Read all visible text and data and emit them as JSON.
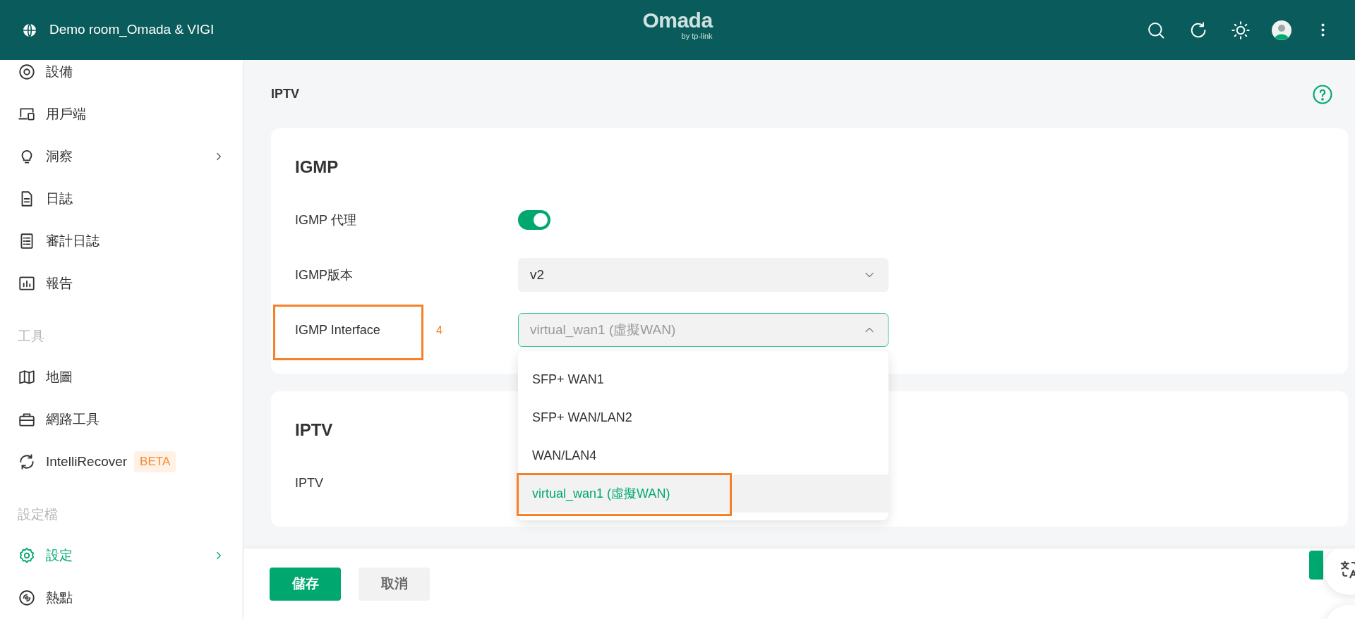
{
  "header": {
    "site_name": "Demo room_Omada & VIGI",
    "logo": "Omada",
    "logo_sub": "by tp-link"
  },
  "sidebar": {
    "items": [
      {
        "kind": "item",
        "label": "設備",
        "selected": false,
        "expandable": false
      },
      {
        "kind": "item",
        "label": "用戶端",
        "selected": false,
        "expandable": false
      },
      {
        "kind": "item",
        "label": "洞察",
        "selected": false,
        "expandable": true
      },
      {
        "kind": "item",
        "label": "日誌",
        "selected": false,
        "expandable": false
      },
      {
        "kind": "item",
        "label": "審計日誌",
        "selected": false,
        "expandable": false
      },
      {
        "kind": "item",
        "label": "報告",
        "selected": false,
        "expandable": false
      },
      {
        "kind": "section",
        "label": "工具"
      },
      {
        "kind": "item",
        "label": "地圖",
        "selected": false,
        "expandable": false
      },
      {
        "kind": "item",
        "label": "網路工具",
        "selected": false,
        "expandable": false
      },
      {
        "kind": "item",
        "label": "IntelliRecover",
        "selected": false,
        "expandable": false,
        "badge": "BETA"
      },
      {
        "kind": "section",
        "label": "設定檔"
      },
      {
        "kind": "item",
        "label": "設定",
        "selected": true,
        "expandable": true
      },
      {
        "kind": "item",
        "label": "熱點",
        "selected": false,
        "expandable": false
      }
    ]
  },
  "main": {
    "page_title": "IPTV",
    "cards": [
      {
        "title": "IGMP",
        "rows": [
          {
            "kind": "toggle",
            "label": "IGMP 代理",
            "on": true
          },
          {
            "kind": "select",
            "label": "IGMP版本",
            "value": "v2",
            "expanded": false
          },
          {
            "kind": "select",
            "label": "IGMP Interface",
            "value": "virtual_wan1 (虛擬WAN)",
            "expanded": true,
            "annotated": true,
            "annotation_number": "4",
            "options": [
              {
                "label": "SFP+ WAN1",
                "selected": false,
                "annotated": false
              },
              {
                "label": "SFP+ WAN/LAN2",
                "selected": false,
                "annotated": false
              },
              {
                "label": "WAN/LAN4",
                "selected": false,
                "annotated": false
              },
              {
                "label": "virtual_wan1 (虛擬WAN)",
                "selected": true,
                "annotated": true
              }
            ]
          }
        ]
      },
      {
        "title": "IPTV",
        "rows": [
          {
            "kind": "plain",
            "label": "IPTV"
          }
        ]
      }
    ]
  },
  "footer": {
    "buttons": [
      {
        "kind": "primary",
        "label": "儲存"
      },
      {
        "kind": "secondary",
        "label": "取消"
      }
    ]
  }
}
